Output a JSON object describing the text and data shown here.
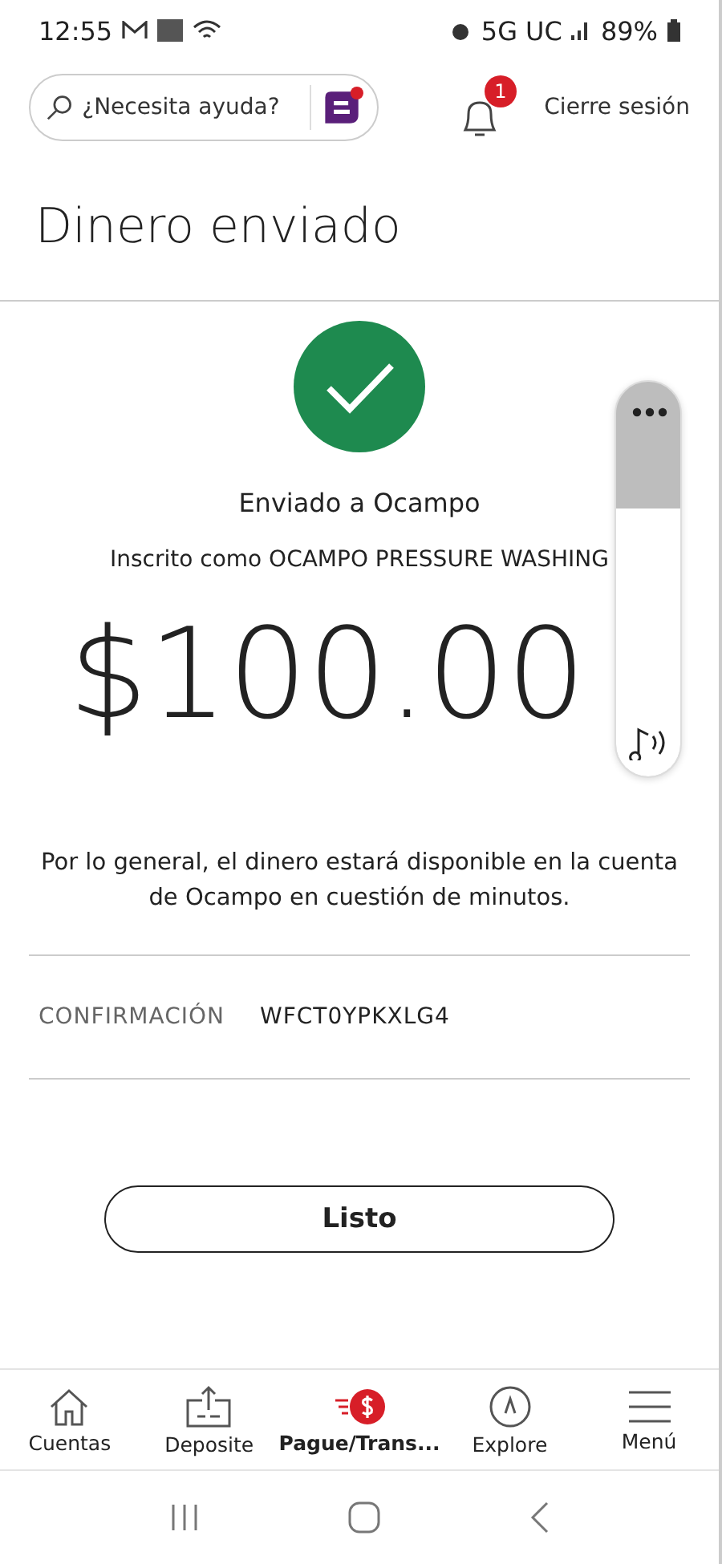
{
  "status_bar": {
    "time": "12:55",
    "network": "5G UC",
    "battery": "89%"
  },
  "header": {
    "search": {
      "placeholder": "¿Necesita ayuda?"
    },
    "notifications": {
      "count": "1"
    },
    "logout": "Cierre sesión"
  },
  "title": "Dinero enviado",
  "result": {
    "sent_to": "Enviado a Ocampo",
    "enrolled_as": "Inscrito como OCAMPO PRESSURE WASHING",
    "amount": "$100.00",
    "note": "Por lo general, el dinero estará disponible en la cuenta de Ocampo en cuestión de minutos."
  },
  "confirmation": {
    "label": "CONFIRMACIÓN",
    "value": "WFCT0YPKXLG4"
  },
  "done_button": "Listo",
  "volume_panel": {
    "level": 0.68
  },
  "bottom_nav": [
    {
      "kind": "home",
      "label": "Cuentas",
      "selected": false
    },
    {
      "kind": "deposit",
      "label": "Deposite",
      "selected": false
    },
    {
      "kind": "pay",
      "label": "Pague/Trans...",
      "selected": true
    },
    {
      "kind": "explore",
      "label": "Explore",
      "selected": false
    },
    {
      "kind": "menu",
      "label": "Menú",
      "selected": false
    }
  ]
}
